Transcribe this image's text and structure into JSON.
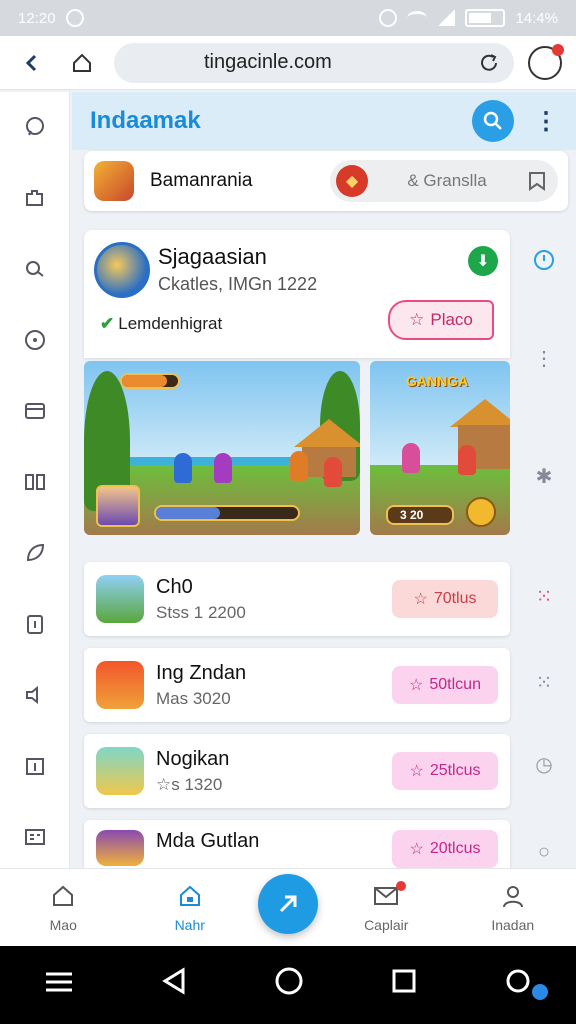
{
  "status_bar": {
    "time": "12:20",
    "battery": "14:4%"
  },
  "browser": {
    "url": "tingacinle.com"
  },
  "header": {
    "title": "Indaamak"
  },
  "top_card": {
    "name": "Bamanrania",
    "search_text": "& Granslla"
  },
  "featured": {
    "name": "Sjagaasian",
    "subtitle": "Ckatles, IMGn 1222",
    "tag": "Lemdenhigrat",
    "play_label": "Placo",
    "hud_value": "3 20",
    "game_logo": "GANNGA"
  },
  "games": [
    {
      "name": "Ch0",
      "sub": "Stss 1 2200",
      "button": "70tlus",
      "style": "peach"
    },
    {
      "name": "Ing Zndan",
      "sub": "Mas 3020",
      "button": "50tlcun",
      "style": "pink"
    },
    {
      "name": "Nogikan",
      "sub": "☆s 1320",
      "button": "25tlcus",
      "style": "pink"
    },
    {
      "name": "Mda Gutlan",
      "sub": "",
      "button": "20tlcus",
      "style": "pink"
    }
  ],
  "bottom_nav": [
    {
      "label": "Mao",
      "icon": "home-icon"
    },
    {
      "label": "Nahr",
      "icon": "store-icon"
    },
    {
      "label": "Caplair",
      "icon": "mail-icon"
    },
    {
      "label": "Inadan",
      "icon": "profile-icon"
    }
  ],
  "colors": {
    "accent": "#1a8bd8",
    "pink": "#e94b85",
    "green": "#1ea64a"
  }
}
